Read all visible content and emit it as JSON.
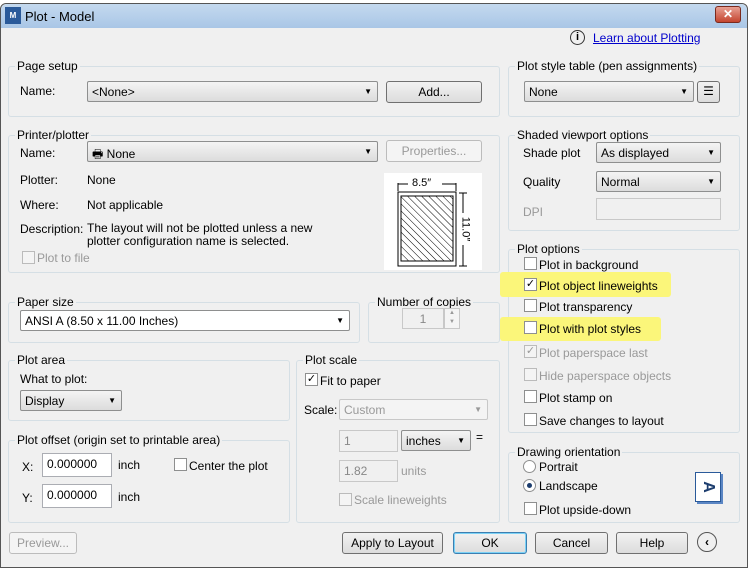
{
  "window": {
    "title": "Plot - Model",
    "app_icon": "autocad-3d-icon",
    "learn_link": "Learn about Plotting"
  },
  "page_setup": {
    "legend": "Page setup",
    "name_label": "Name:",
    "name_value": "<None>",
    "add_button": "Add..."
  },
  "printer": {
    "legend": "Printer/plotter",
    "name_label": "Name:",
    "name_value": "None",
    "properties_button": "Properties...",
    "plotter_label": "Plotter:",
    "plotter_value": "None",
    "where_label": "Where:",
    "where_value": "Not applicable",
    "description_label": "Description:",
    "description_value": "The layout will not be plotted unless a new plotter configuration name is selected.",
    "plot_to_file": "Plot to file",
    "preview_width": "8.5″",
    "preview_height": "11.0″"
  },
  "paper_size": {
    "legend": "Paper size",
    "value": "ANSI A (8.50 x 11.00 Inches)"
  },
  "copies": {
    "legend": "Number of copies",
    "value": "1"
  },
  "plot_area": {
    "legend": "Plot area",
    "what_label": "What to plot:",
    "what_value": "Display"
  },
  "plot_offset": {
    "legend": "Plot offset (origin set to printable area)",
    "x_label": "X:",
    "x_value": "0.000000",
    "y_label": "Y:",
    "y_value": "0.000000",
    "unit": "inch",
    "center": "Center the plot"
  },
  "plot_scale": {
    "legend": "Plot scale",
    "fit": "Fit to paper",
    "scale_label": "Scale:",
    "scale_value": "Custom",
    "num": "1",
    "unit_value": "inches",
    "equals": "=",
    "den": "1.82",
    "units_label": "units",
    "scale_lw": "Scale lineweights"
  },
  "plot_style_table": {
    "legend": "Plot style table (pen assignments)",
    "value": "None"
  },
  "shaded": {
    "legend": "Shaded viewport options",
    "shade_label": "Shade plot",
    "shade_value": "As displayed",
    "quality_label": "Quality",
    "quality_value": "Normal",
    "dpi_label": "DPI"
  },
  "plot_options": {
    "legend": "Plot options",
    "items": [
      {
        "label": "Plot in background",
        "checked": false
      },
      {
        "label": "Plot object lineweights",
        "checked": true
      },
      {
        "label": "Plot transparency",
        "checked": false
      },
      {
        "label": "Plot with plot styles",
        "checked": false
      },
      {
        "label": "Plot paperspace last",
        "checked": true
      },
      {
        "label": "Hide paperspace objects",
        "checked": false
      },
      {
        "label": "Plot stamp on",
        "checked": false
      },
      {
        "label": "Save changes to layout",
        "checked": false
      }
    ],
    "highlight_color": "#fbf67a"
  },
  "orientation": {
    "legend": "Drawing orientation",
    "portrait": "Portrait",
    "landscape": "Landscape",
    "upside": "Plot upside-down",
    "icon_letter": "A"
  },
  "footer": {
    "preview": "Preview...",
    "apply": "Apply to Layout",
    "ok": "OK",
    "cancel": "Cancel",
    "help": "Help"
  }
}
